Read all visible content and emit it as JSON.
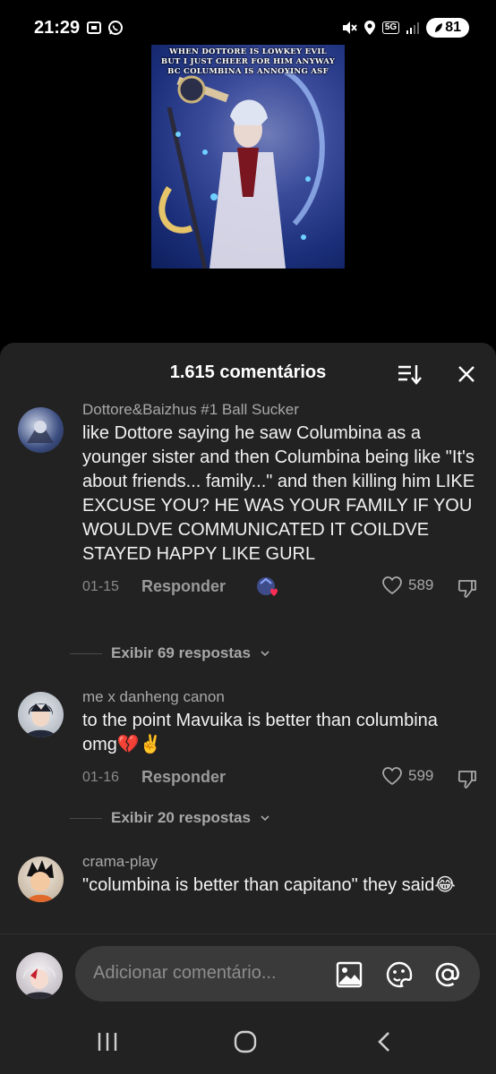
{
  "status_bar": {
    "time": "21:29",
    "battery": "81",
    "network": "5G"
  },
  "video": {
    "caption_line1": "WHEN DOTTORE IS LOWKEY EVIL",
    "caption_line2": "BUT I JUST CHEER FOR HIM ANYWAY",
    "caption_line3": "BC COLUMBINA IS ANNOYING ASF"
  },
  "sheet": {
    "title": "1.615 comentários"
  },
  "comments": [
    {
      "username": "Dottore&Baizhus #1 Ball Sucker",
      "text": "like Dottore saying he saw Columbina as a younger sister and then Columbina being like \"It's about friends... family...\" and then killing him LIKE EXCUSE YOU? HE WAS YOUR FAMILY IF YOU WOULDVE COMMUNICATED IT COILDVE STAYED HAPPY LIKE GURL",
      "date": "01-15",
      "reply_label": "Responder",
      "likes": "589",
      "view_replies": "Exibir 69 respostas"
    },
    {
      "username": "me x danheng canon",
      "text": "to the point Mavuika is better than columbina omg💔✌️",
      "date": "01-16",
      "reply_label": "Responder",
      "likes": "599",
      "view_replies": "Exibir 20 respostas"
    },
    {
      "username": "crama-play",
      "text": "\"columbina is better than capitano\" they said😂"
    }
  ],
  "composer": {
    "placeholder": "Adicionar comentário..."
  },
  "colors": {
    "sheet_bg": "#222222",
    "input_bg": "#3a3a3a",
    "secondary_text": "#a8a8a8"
  }
}
